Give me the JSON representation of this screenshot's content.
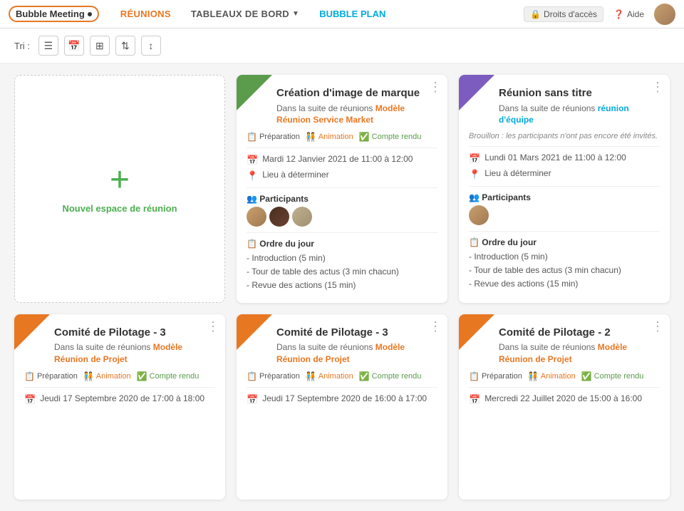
{
  "navbar": {
    "brand": "Bubble Meeting",
    "nav_items": [
      "RÉUNIONS",
      "TABLEAUX DE BORD",
      "BUBBLE PLAN"
    ],
    "rights_label": "Droits d'accès",
    "help_label": "Aide"
  },
  "toolbar": {
    "label": "Tri :"
  },
  "cards": [
    {
      "id": "new",
      "type": "new",
      "label": "Nouvel espace de réunion"
    },
    {
      "id": "card1",
      "type": "regular",
      "corner": "green",
      "title": "Création d'image de marque",
      "subtitle_prefix": "Dans la suite de réunions",
      "subtitle_link": "Modèle Réunion Service Market",
      "subtitle_link_color": "orange",
      "badges": [
        {
          "label": "Préparation",
          "type": "prep",
          "icon": "📋"
        },
        {
          "label": "Animation",
          "type": "anim",
          "icon": "👥"
        },
        {
          "label": "Compte rendu",
          "type": "cr",
          "icon": "✅"
        }
      ],
      "date": "Mardi 12 Janvier 2021 de 11:00 à 12:00",
      "location": "Lieu à déterminer",
      "has_participants": true,
      "participants_count": 3,
      "agenda": [
        "- Introduction (5 min)",
        "- Tour de table des actus (3 min chacun)",
        "- Revue des actions (15 min)"
      ],
      "note": null
    },
    {
      "id": "card2",
      "type": "regular",
      "corner": "purple",
      "title": "Réunion sans titre",
      "subtitle_prefix": "Dans la suite de réunions",
      "subtitle_link": "réunion d'équipe",
      "subtitle_link_color": "blue",
      "badges": [],
      "date": "Lundi 01 Mars 2021 de 11:00 à 12:00",
      "location": "Lieu à déterminer",
      "has_participants": true,
      "participants_count": 1,
      "agenda": [
        "- Introduction (5 min)",
        "- Tour de table des actus (3 min chacun)",
        "- Revue des actions (15 min)"
      ],
      "note": "Brouillon : les participants n'ont pas encore été invités."
    },
    {
      "id": "card3",
      "type": "regular",
      "corner": "orange",
      "title": "Comité de Pilotage - 3",
      "subtitle_prefix": "Dans la suite de réunions",
      "subtitle_link": "Modèle Réunion de Projet",
      "subtitle_link_color": "orange",
      "badges": [
        {
          "label": "Préparation",
          "type": "prep",
          "icon": "📋"
        },
        {
          "label": "Animation",
          "type": "anim",
          "icon": "👥"
        },
        {
          "label": "Compte rendu",
          "type": "cr",
          "icon": "✅"
        }
      ],
      "date": "Jeudi 17 Septembre 2020 de 17:00 à 18:00",
      "location": null,
      "has_participants": false,
      "agenda": [],
      "note": null
    },
    {
      "id": "card4",
      "type": "regular",
      "corner": "orange",
      "title": "Comité de Pilotage - 3",
      "subtitle_prefix": "Dans la suite de réunions",
      "subtitle_link": "Modèle Réunion de Projet",
      "subtitle_link_color": "orange",
      "badges": [
        {
          "label": "Préparation",
          "type": "prep",
          "icon": "📋"
        },
        {
          "label": "Animation",
          "type": "anim",
          "icon": "👥"
        },
        {
          "label": "Compte rendu",
          "type": "cr",
          "icon": "✅"
        }
      ],
      "date": "Jeudi 17 Septembre 2020 de 16:00 à 17:00",
      "location": null,
      "has_participants": false,
      "agenda": [],
      "note": null
    },
    {
      "id": "card5",
      "type": "regular",
      "corner": "orange",
      "title": "Comité de Pilotage - 2",
      "subtitle_prefix": "Dans la suite de réunions",
      "subtitle_link": "Modèle Réunion de Projet",
      "subtitle_link_color": "orange",
      "badges": [
        {
          "label": "Préparation",
          "type": "prep",
          "icon": "📋"
        },
        {
          "label": "Animation",
          "type": "anim",
          "icon": "👥"
        },
        {
          "label": "Compte rendu",
          "type": "cr",
          "icon": "✅"
        }
      ],
      "date": "Mercredi 22 Juillet 2020 de 15:00 à 16:00",
      "location": null,
      "has_participants": false,
      "agenda": [],
      "note": null
    }
  ]
}
